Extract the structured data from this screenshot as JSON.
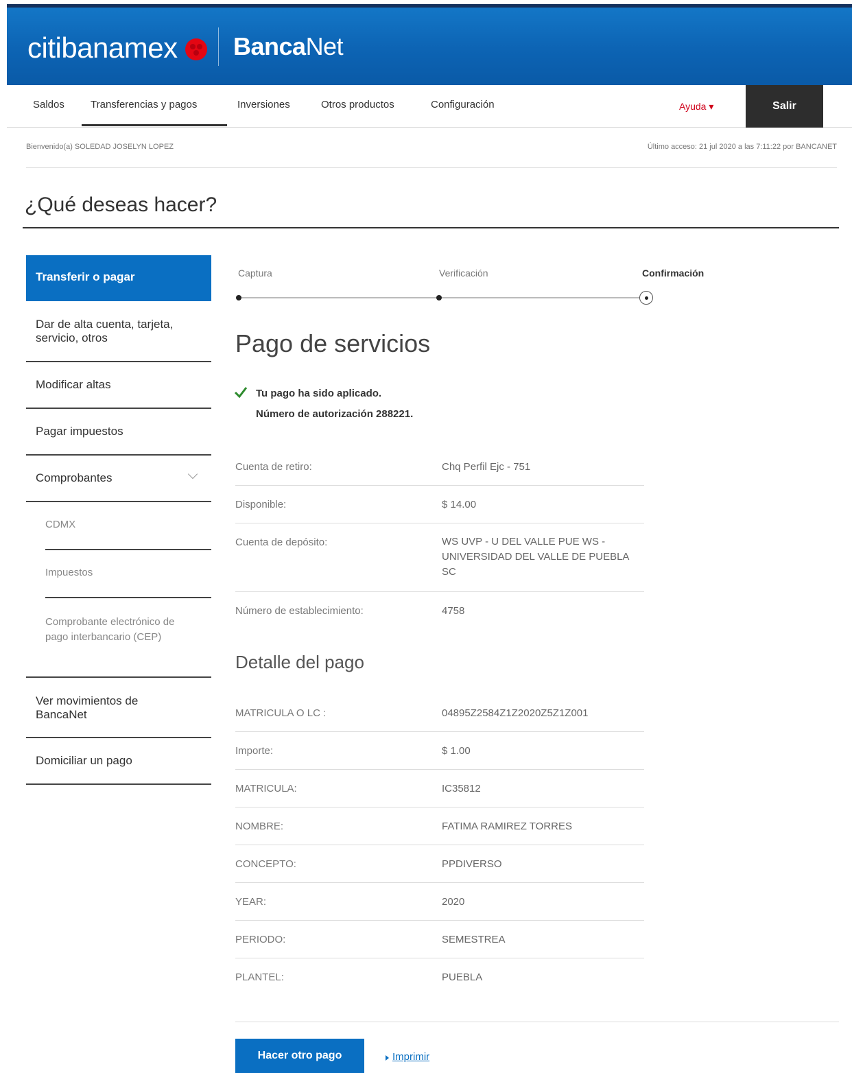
{
  "brand": {
    "citi": "citibanamex",
    "banca": "Banca",
    "net": "Net",
    "mark_color": "#e30613"
  },
  "nav": {
    "items": [
      "Saldos",
      "Transferencias y pagos",
      "Inversiones",
      "Otros productos",
      "Configuración"
    ],
    "active": "Transferencias y pagos",
    "help": "Ayuda",
    "logout": "Salir"
  },
  "session": {
    "welcome": "Bienvenido(a) SOLEDAD JOSELYN LOPEZ",
    "last_access": "Último acceso: 21 jul 2020 a las 7:11:22 por BANCANET"
  },
  "page_title": "¿Qué deseas hacer?",
  "sidebar": {
    "active": "Transferir o pagar",
    "items": [
      "Dar de alta cuenta, tarjeta, servicio, otros",
      "Modificar altas",
      "Pagar impuestos",
      "Comprobantes",
      "Ver movimientos de BancaNet",
      "Domiciliar un pago"
    ],
    "subitems": [
      "CDMX",
      "Impuestos",
      "Comprobante electrónico de pago interbancario (CEP)"
    ]
  },
  "steps": [
    "Captura",
    "Verificación",
    "Confirmación"
  ],
  "section_title": "Pago de servicios",
  "confirmation": {
    "message": "Tu pago ha sido aplicado.",
    "authorization": "Número de autorización 288221."
  },
  "account_rows": [
    {
      "label": "Cuenta de retiro:",
      "value": "Chq Perfil Ejc - 751"
    },
    {
      "label": "Disponible:",
      "value": "$ 14.00"
    },
    {
      "label": "Cuenta de depósito:",
      "value": "WS UVP - U DEL VALLE PUE WS - UNIVERSIDAD DEL VALLE DE PUEBLA SC"
    },
    {
      "label": "Número de establecimiento:",
      "value": "4758"
    }
  ],
  "detail_title": "Detalle del pago",
  "detail_rows": [
    {
      "label": "MATRICULA O LC :",
      "value": "04895Z2584Z1Z2020Z5Z1Z001"
    },
    {
      "label": "Importe:",
      "value": "$ 1.00"
    },
    {
      "label": "MATRICULA:",
      "value": "IC35812"
    },
    {
      "label": "NOMBRE:",
      "value": "FATIMA RAMIREZ TORRES"
    },
    {
      "label": "CONCEPTO:",
      "value": "PPDIVERSO"
    },
    {
      "label": "YEAR:",
      "value": "2020"
    },
    {
      "label": "PERIODO:",
      "value": "SEMESTREA"
    },
    {
      "label": "PLANTEL:",
      "value": "PUEBLA"
    }
  ],
  "actions": {
    "another_payment": "Hacer otro pago",
    "print": "Imprimir"
  }
}
